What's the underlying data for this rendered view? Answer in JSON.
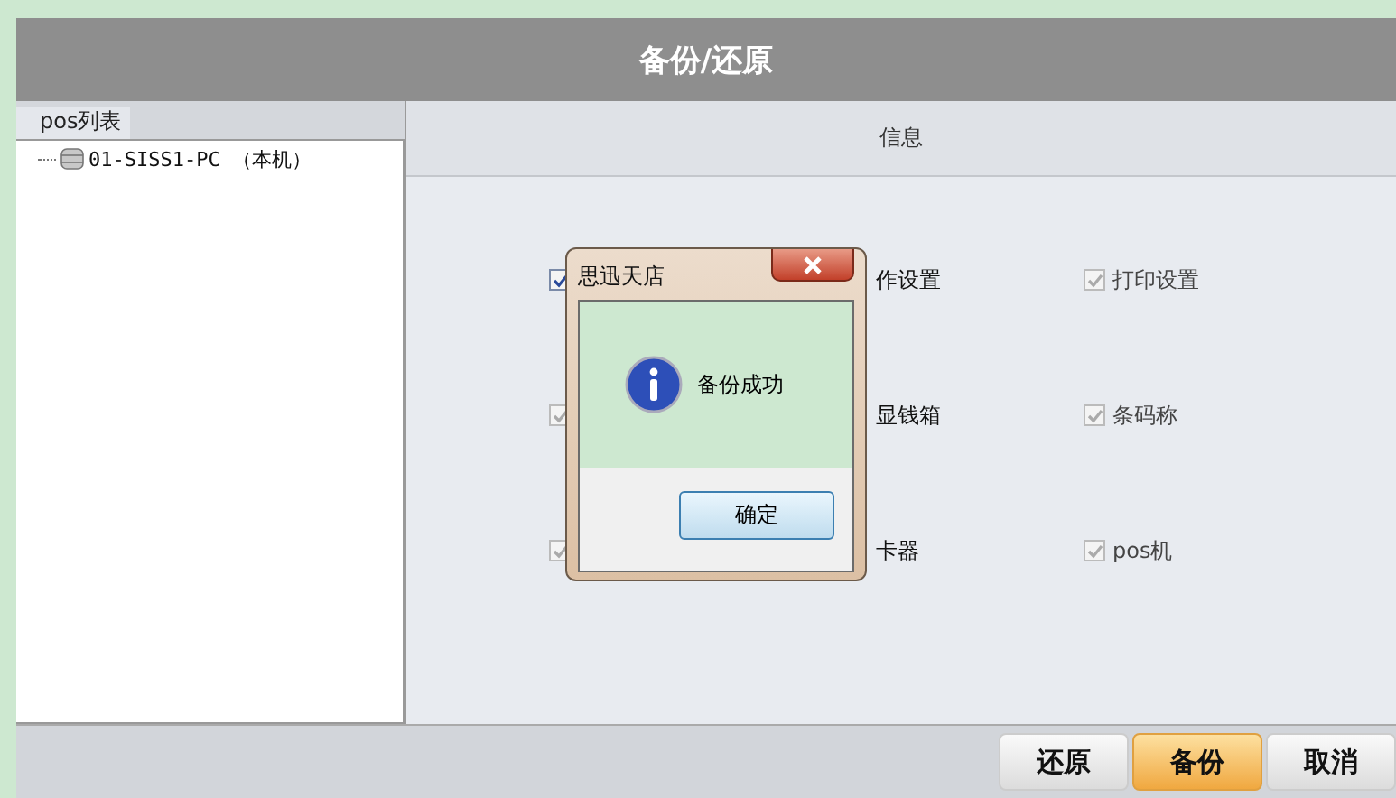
{
  "window": {
    "title": "备份/还原"
  },
  "pos_list": {
    "header": "pos列表",
    "items": [
      {
        "label": "01-SISS1-PC （本机）"
      }
    ]
  },
  "info": {
    "header": "信息",
    "options": [
      {
        "kind": "box",
        "checked": true,
        "disabled": false
      },
      {
        "kind": "text",
        "label": "作设置"
      },
      {
        "kind": "full",
        "label": "打印设置",
        "checked": true,
        "disabled": true
      },
      {
        "kind": "box",
        "checked": true,
        "disabled": true
      },
      {
        "kind": "text",
        "label": "显钱箱"
      },
      {
        "kind": "full",
        "label": "条码称",
        "checked": true,
        "disabled": true
      },
      {
        "kind": "box",
        "checked": true,
        "disabled": true
      },
      {
        "kind": "text",
        "label": "卡器"
      },
      {
        "kind": "full",
        "label": "pos机",
        "checked": true,
        "disabled": true
      }
    ]
  },
  "dialog": {
    "title": "思迅天店",
    "message": "备份成功",
    "button": "确定"
  },
  "buttons": [
    {
      "label": "还原",
      "selected": false
    },
    {
      "label": "备份",
      "selected": true
    },
    {
      "label": "取消",
      "selected": false
    }
  ]
}
